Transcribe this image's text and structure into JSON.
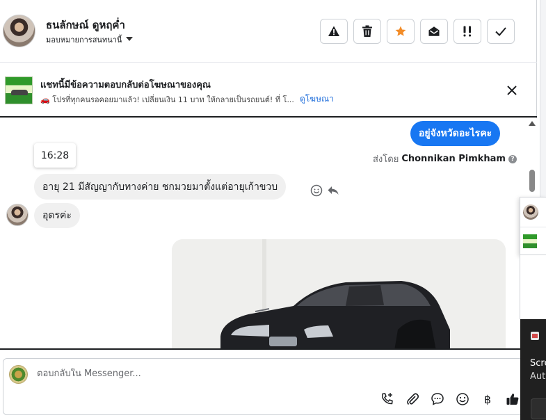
{
  "header": {
    "contact_name": "ธนลักษณ์ ดูหฤค่ำ",
    "assign_label": "มอบหมายการสนทนานี้",
    "actions": [
      {
        "name": "report-spam",
        "icon": "alert-icon"
      },
      {
        "name": "delete",
        "icon": "trash-icon"
      },
      {
        "name": "star",
        "icon": "star-icon",
        "color": "#f28c28"
      },
      {
        "name": "mark-unread",
        "icon": "envelope-open-icon"
      },
      {
        "name": "priority",
        "icon": "double-exclamation-icon"
      },
      {
        "name": "mark-done",
        "icon": "check-icon"
      }
    ]
  },
  "ad_banner": {
    "title": "แชทนี้มีข้อความตอบกลับต่อโฆษณาของคุณ",
    "subtitle": "🚗 โปรที่ทุกคนรอคอยมาแล้ว! เปลี่ยนเงิน 11 บาท ให้กลายเป็นรถยนต์! ที่ โ...",
    "link": "ดูโฆษณา"
  },
  "messages": {
    "outgoing_text": "อยู่จังหวัดอะไรคะ",
    "sent_by_prefix": "ส่งโดย",
    "sent_by_name": "Chonnikan Pimkham",
    "sent_by_help": "?",
    "time": "16:28",
    "incoming_1": "อายุ 21 มีสัญญากับทางค่าย ชกมวยมาตั้งแต่อายุเก้าขวบ",
    "incoming_2": "อุดรค่ะ"
  },
  "composer": {
    "placeholder": "ตอบกลับใน Messenger...",
    "tools": [
      "call-add-icon",
      "paperclip-icon",
      "chat-bubble-icon",
      "emoji-icon",
      "baht-icon",
      "thumbs-up-icon"
    ],
    "baht_symbol": "฿"
  },
  "side": {
    "toast_line1": "Scre",
    "toast_line2": "Aut"
  },
  "colors": {
    "accent": "#1877f2",
    "star": "#f28c28",
    "link": "#216fdb"
  }
}
